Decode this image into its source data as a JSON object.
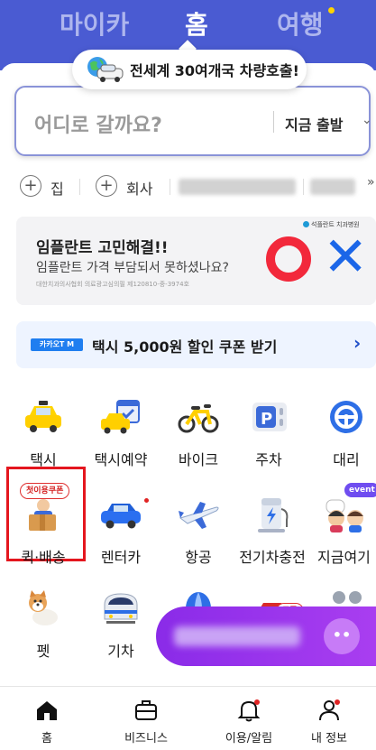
{
  "top_tabs": {
    "mycar": "마이카",
    "home": "홈",
    "travel": "여행"
  },
  "banner": {
    "text": "전세계 30여개국 차량호출!"
  },
  "search": {
    "placeholder": "어디로 갈까요?",
    "depart": "지금 출발"
  },
  "shortcuts": [
    {
      "label": "집"
    },
    {
      "label": "회사"
    }
  ],
  "ad": {
    "title": "임플란트 고민해결!!",
    "subtitle": "임플란트 가격 부담되서 못하셨나요?",
    "fine_print": "대한치과의사협회 의료광고심의필 제120810-중-3974호",
    "badge": "석플란트 치과병원"
  },
  "coupon_banner": {
    "badge": "카카오T M",
    "text": "택시 5,000원 할인 쿠폰 받기"
  },
  "services": [
    {
      "label": "택시",
      "icon": "taxi-icon"
    },
    {
      "label": "택시예약",
      "icon": "taxi-reservation-icon"
    },
    {
      "label": "바이크",
      "icon": "bike-icon"
    },
    {
      "label": "주차",
      "icon": "parking-icon"
    },
    {
      "label": "대리",
      "icon": "designated-driver-icon"
    },
    {
      "label": "퀵·배송",
      "icon": "delivery-box-icon",
      "tag": "첫이용쿠폰"
    },
    {
      "label": "렌터카",
      "icon": "rental-car-icon"
    },
    {
      "label": "항공",
      "icon": "airplane-icon"
    },
    {
      "label": "전기차충전",
      "icon": "ev-charger-icon"
    },
    {
      "label": "지금여기",
      "icon": "people-icon",
      "tag": "event"
    },
    {
      "label": "펫",
      "icon": "dog-icon"
    },
    {
      "label": "기차",
      "icon": "train-icon"
    },
    {
      "label": "",
      "icon": "balloon-icon"
    },
    {
      "label": "",
      "icon": "car-icon",
      "tag": "쿠폰"
    },
    {
      "label": "",
      "icon": "more-dots-icon"
    }
  ],
  "bottom_nav": [
    {
      "label": "홈",
      "icon": "home-icon"
    },
    {
      "label": "비즈니스",
      "icon": "briefcase-icon"
    },
    {
      "label": "이용/알림",
      "icon": "bell-icon"
    },
    {
      "label": "내 정보",
      "icon": "person-icon"
    }
  ],
  "colors": {
    "brand_blue": "#4a5bd2",
    "highlight_red": "#e4161e",
    "float_purple": "#9a35ec"
  }
}
